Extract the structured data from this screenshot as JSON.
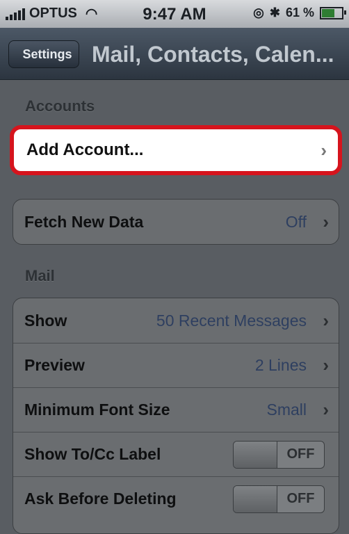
{
  "status": {
    "carrier": "OPTUS",
    "time": "9:47 AM",
    "battery": "61 %",
    "battery_level": 0.61
  },
  "nav": {
    "back_label": "Settings",
    "title": "Mail, Contacts, Calen..."
  },
  "sections": {
    "accounts": "Accounts",
    "mail": "Mail"
  },
  "accounts": {
    "add_account": "Add Account..."
  },
  "fetch": {
    "label": "Fetch New Data",
    "value": "Off"
  },
  "mail": {
    "rows": [
      {
        "label": "Show",
        "value": "50 Recent Messages"
      },
      {
        "label": "Preview",
        "value": "2 Lines"
      },
      {
        "label": "Minimum Font Size",
        "value": "Small"
      }
    ],
    "toggles": [
      {
        "label": "Show To/Cc Label",
        "state": "OFF"
      },
      {
        "label": "Ask Before Deleting",
        "state": "OFF"
      }
    ]
  },
  "colors": {
    "highlight_border": "#d6141d",
    "nav_bg": "#2c3540",
    "value_text": "#2e3f60"
  },
  "icons": {
    "chevron": "chevron-right-icon",
    "wifi": "wifi-icon",
    "bluetooth": "bluetooth-icon",
    "alarm": "alarm-icon",
    "battery": "battery-icon",
    "signal": "signal-bars-icon"
  }
}
